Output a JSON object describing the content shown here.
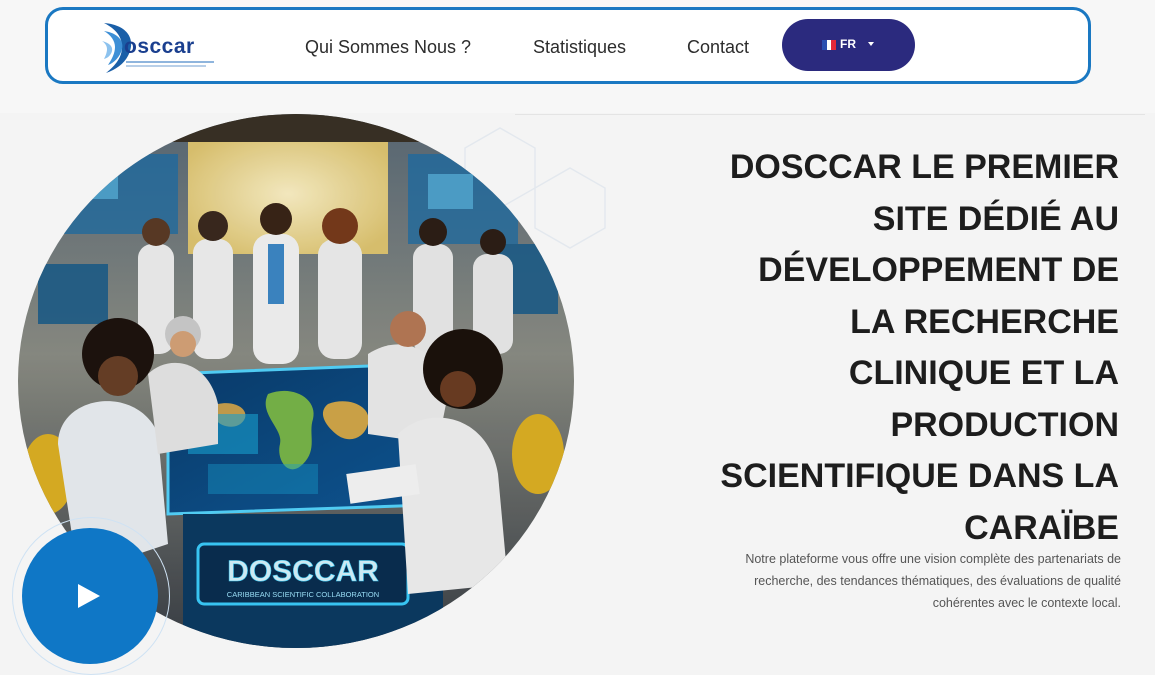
{
  "brand": {
    "logo_text": "osccar"
  },
  "nav": {
    "items": [
      {
        "label": "Qui Sommes Nous ?"
      },
      {
        "label": "Statistiques"
      },
      {
        "label": "Contact"
      }
    ],
    "language": {
      "label": "FR"
    }
  },
  "hero": {
    "headline_lines": [
      "DOSCCAR LE PREMIER",
      "SITE DÉDIÉ AU",
      "DÉVELOPPEMENT DE",
      "LA RECHERCHE",
      "CLINIQUE ET LA",
      "PRODUCTION",
      "SCIENTIFIQUE DANS LA",
      "CARAÏBE"
    ],
    "subtitle_lines": [
      "Notre plateforme vous offre une vision complète des partenariats de",
      "recherche, des tendances thématiques, des évaluations de qualité",
      "cohérentes avec le contexte local."
    ],
    "image": {
      "sign_title": "DOSCCAR",
      "sign_subtitle": "CARIBBEAN SCIENTIFIC COLLABORATION"
    }
  },
  "colors": {
    "accent": "#1a78c2",
    "language_button": "#2b2a7e",
    "play_button": "#0f77c6",
    "headline": "#1d1d1d"
  },
  "icons": [
    "logo-mark-icon",
    "france-flag-icon",
    "chevron-down-icon",
    "play-icon"
  ]
}
